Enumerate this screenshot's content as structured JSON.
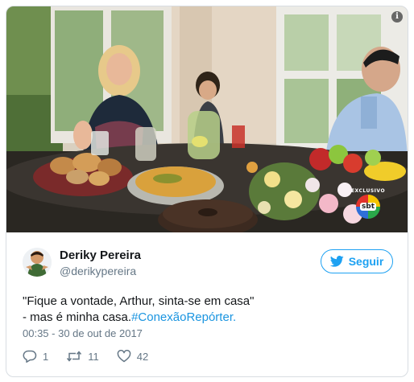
{
  "media": {
    "badge_label": "EXCLUSIVO",
    "badge_logo": "sbt",
    "icons": [
      "info-icon"
    ]
  },
  "tweet": {
    "author_name": "Deriky Pereira",
    "author_handle": "@derikypereira",
    "follow_label": "Seguir",
    "text_line1": "\"Fique a vontade, Arthur, sinta-se em casa\"",
    "text_line2_prefix": "- mas é minha casa.",
    "hashtag": "#ConexãoRepórter.",
    "timestamp": "00:35 - 30 de out de 2017",
    "reply_count": "1",
    "retweet_count": "11",
    "like_count": "42"
  },
  "colors": {
    "accent": "#1da1f2",
    "hashtag": "#1b95e0",
    "muted": "#657786",
    "border": "#d8dde2"
  }
}
